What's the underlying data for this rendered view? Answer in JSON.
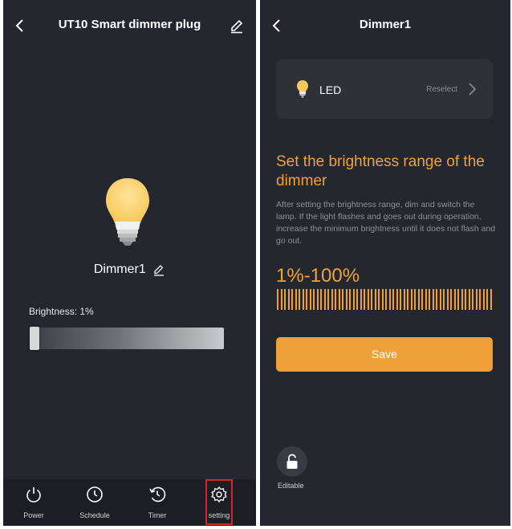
{
  "left_screen": {
    "title": "UT10 Smart dimmer plug",
    "device_name": "Dimmer1",
    "brightness_label": "Brightness: 1%",
    "brightness_value_percent": 1,
    "nav": [
      {
        "label": "Power",
        "icon": "power-icon"
      },
      {
        "label": "Schedule",
        "icon": "clock-icon"
      },
      {
        "label": "Timer",
        "icon": "timer-icon"
      },
      {
        "label": "setting",
        "icon": "gear-icon",
        "highlighted": true
      }
    ],
    "highlight_color": "#d7232b"
  },
  "right_screen": {
    "title": "Dimmer1",
    "lamp_type": "LED",
    "reselect_label": "Reselect",
    "heading": "Set the brightness range of the dimmer",
    "description": "After setting the brightness range, dim and switch the lamp. If the light flashes and goes out during operation, increase the minimum brightness until it does not flash and go out.",
    "range_text": "1%-100%",
    "save_label": "Save",
    "editable_label": "Editable",
    "accent_color": "#f0a23a"
  }
}
